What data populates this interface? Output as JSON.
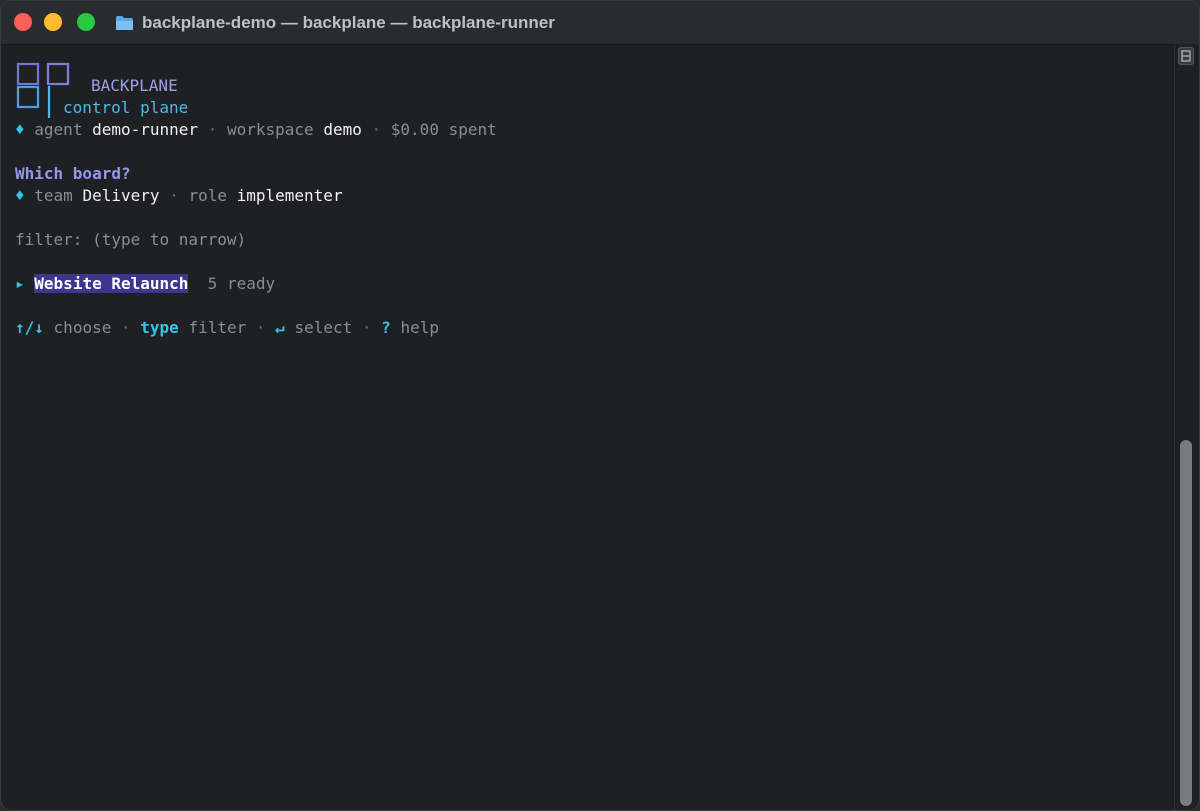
{
  "window": {
    "title": "backplane-demo — backplane — backplane-runner",
    "icon": "folder-icon"
  },
  "brand": {
    "logo_icon": "bp-logo-icon",
    "name": "BACKPLANE",
    "subtitle": "control plane"
  },
  "status": {
    "agent_label": "agent",
    "agent_value": "demo-runner",
    "workspace_label": "workspace",
    "workspace_value": "demo",
    "spent": "$0.00 spent"
  },
  "prompt": {
    "question": "Which board?",
    "team_label": "team",
    "team_value": "Delivery",
    "role_label": "role",
    "role_value": "implementer"
  },
  "filter": {
    "text": "filter: (type to narrow)"
  },
  "boards": [
    {
      "name": "Website Relaunch",
      "count": "5 ready",
      "selected": true
    }
  ],
  "hints": {
    "choose_key": "↑/↓",
    "choose_label": "choose",
    "filter_key": "type",
    "filter_label": "filter",
    "select_key": "↵",
    "select_label": "select",
    "help_key": "?",
    "help_label": "help"
  },
  "glyphs": {
    "diamond": "♦",
    "separator": "·",
    "pointer": "▸"
  },
  "colors": {
    "background": "#1f2024",
    "accent_cyan": "#31c6e8",
    "accent_purple": "#9297ef",
    "selection": "#3b3690"
  }
}
